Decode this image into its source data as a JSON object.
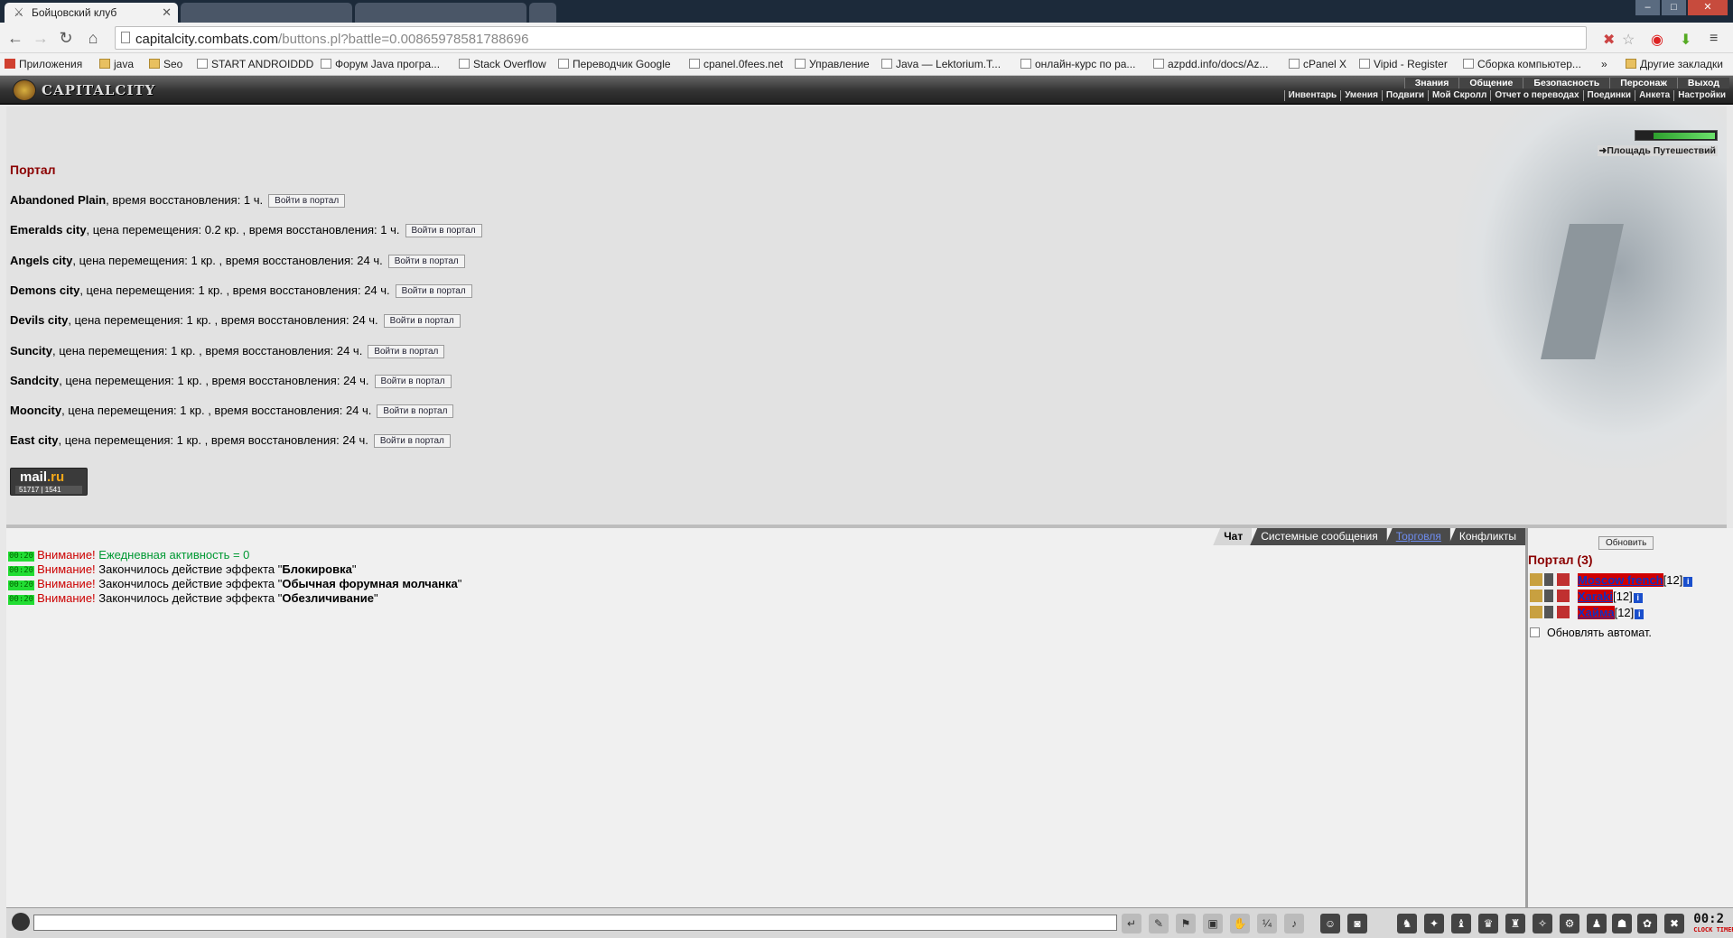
{
  "browser": {
    "tab_title": "Бойцовский клуб",
    "url_domain": "capitalcity.combats.com",
    "url_path": "/buttons.pl?battle=0.00865978581788696",
    "window_buttons": [
      "–",
      "□",
      "✕"
    ],
    "bookmarks": [
      {
        "label": "Приложения",
        "icon": "apps"
      },
      {
        "label": "java",
        "icon": "folder"
      },
      {
        "label": "Seo",
        "icon": "folder"
      },
      {
        "label": "START ANDROIDDD",
        "icon": "page"
      },
      {
        "label": "Форум Java програ...",
        "icon": "page"
      },
      {
        "label": "Stack Overflow",
        "icon": "page"
      },
      {
        "label": "Переводчик Google",
        "icon": "page"
      },
      {
        "label": "cpanel.0fees.net",
        "icon": "page"
      },
      {
        "label": "Управление",
        "icon": "page"
      },
      {
        "label": "Java — Lektorium.T...",
        "icon": "page"
      },
      {
        "label": "онлайн-курс по ра...",
        "icon": "page"
      },
      {
        "label": "azpdd.info/docs/Az...",
        "icon": "page"
      },
      {
        "label": "cPanel X",
        "icon": "page"
      },
      {
        "label": "Vipid - Register",
        "icon": "page"
      },
      {
        "label": "Сборка компьютер...",
        "icon": "page"
      },
      {
        "label": "»",
        "icon": "none"
      },
      {
        "label": "Другие закладки",
        "icon": "folder"
      }
    ]
  },
  "game": {
    "logo": "CAPITALCITY",
    "menu_top": [
      "Знания",
      "Общение",
      "Безопасность",
      "Персонаж",
      "Выход"
    ],
    "menu_bottom": [
      "Инвентарь",
      "Умения",
      "Подвиги",
      "Мой Скролл",
      "Отчет о переводах",
      "Поединки",
      "Анкета",
      "Настройки"
    ],
    "travel_link": "➜Площадь Путешествий",
    "portal_title": "Портал",
    "enter_label": "Войти в портал",
    "portals": [
      {
        "name": "Abandoned Plain",
        "info": ", время восстановления: 1 ч."
      },
      {
        "name": "Emeralds city",
        "info": ", цена перемещения: 0.2 кр. , время восстановления: 1 ч."
      },
      {
        "name": "Angels city",
        "info": ", цена перемещения: 1 кр. , время восстановления: 24 ч."
      },
      {
        "name": "Demons city",
        "info": ", цена перемещения: 1 кр. , время восстановления: 24 ч."
      },
      {
        "name": "Devils city",
        "info": ", цена перемещения: 1 кр. , время восстановления: 24 ч."
      },
      {
        "name": "Suncity",
        "info": ", цена перемещения: 1 кр. , время восстановления: 24 ч."
      },
      {
        "name": "Sandcity",
        "info": ", цена перемещения: 1 кр. , время восстановления: 24 ч."
      },
      {
        "name": "Mooncity",
        "info": ", цена перемещения: 1 кр. , время восстановления: 24 ч."
      },
      {
        "name": "East city",
        "info": ", цена перемещения: 1 кр. , время восстановления: 24 ч."
      }
    ],
    "mailru": {
      "brand_a": "mail",
      "brand_b": ".ru",
      "count1": "51717",
      "count2": "1541"
    }
  },
  "chat": {
    "tabs": [
      "Чат",
      "Системные сообщения",
      "Торговля",
      "Конфликты"
    ],
    "messages": [
      {
        "time": "00:20",
        "warn": "Внимание!",
        "text": " Ежедневная активность = 0",
        "effect": ""
      },
      {
        "time": "00:20",
        "warn": "Внимание!",
        "text": " Закончилось действие эффекта \"",
        "effect": "Блокировка"
      },
      {
        "time": "00:20",
        "warn": "Внимание!",
        "text": " Закончилось действие эффекта \"",
        "effect": "Обычная форумная молчанка"
      },
      {
        "time": "00:20",
        "warn": "Внимание!",
        "text": " Закончилось действие эффекта \"",
        "effect": "Обезличивание"
      }
    ],
    "quote": "\""
  },
  "room": {
    "refresh_label": "Обновить",
    "title": "Портал (3)",
    "users": [
      {
        "name": "Moscow french",
        "level": "[12]",
        "info": "i"
      },
      {
        "name": "Xaraki",
        "level": "[12]",
        "info": "i"
      },
      {
        "name": "Хайма",
        "level": "[12]",
        "info": "i"
      }
    ],
    "auto_refresh_label": "Обновлять автомат."
  },
  "bottom": {
    "clock": "00:2",
    "clock_sub": "CLOCK  TIMER",
    "tools": [
      "↵",
      "✎",
      "⚑",
      "▣",
      "✋",
      "¼",
      "♪",
      "☺",
      "◙",
      "♞",
      "✦",
      "♝",
      "♛",
      "♜",
      "✧",
      "⚙",
      "♟",
      "☗",
      "✿",
      "✖"
    ]
  },
  "colors": {
    "portal_title": "#8b0000",
    "chat_warn": "#cc0000",
    "chat_green": "#009933",
    "timestamp_bg": "#22dd33",
    "user_name_bg": "#d00000"
  }
}
